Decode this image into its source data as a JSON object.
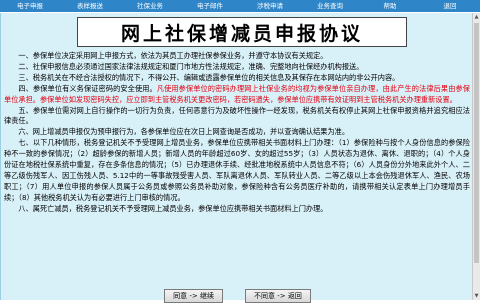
{
  "nav": {
    "items": [
      "电子申报",
      "表样报送",
      "社保业务",
      "电子邮件",
      "涉税申请",
      "业务查询",
      "帮助",
      "退回"
    ]
  },
  "title": "网上社保增减员申报协议",
  "paragraphs": {
    "p1": "一、参保单位决定采用网上申报方式，依法为其员工办理社保参保业务，并遵守本协议有关规定。",
    "p2": "二、社保申报信息必须通过国家法律法规规定和厦门市地方性法规规定，准确、完整地向社保经办机构报送。",
    "p3": "三、税务机关在不经合法授权的情况下，不得公开、编辑或透露参保单位的相关信息及其保存在本网站内的非公开内容。",
    "p4_a": "四、参保单位有义务保证密码的安全使用。",
    "p4_red": "凡使用参保单位的密码办理网上社保业务的均视为参保单位亲自办理，由此产生的法律后果由参保单位承担。参保单位如发现密码失控，应立即到主管税务机关更改密码，若密码遗失，参保单位应携带有效证明到主管税务机关办理重新设置。",
    "p5": "五、参保单位需对网上自行操作的一切行为负责，任何恶意行为及破坏性操作一经发现，税务机关有权停止其网上社保申报资格并追究相应法律责任。",
    "p6": "六、网上增减员申报仅为预申报行为，各参保单位应在次日上网查询是否成功，并以查询确认结果为准。",
    "p7": "七、以下几种情形，税务登记机关不予受理网上增员业务，参保单位应携带相关书面材料上门办理：（1）参保险种与按个人身份信息的参保险种不一致的参保情况；（2）超龄参保的新增人员；新增人员的年龄超过60岁、女的超过55岁；（3）人员状态为退休、离休、退职的；（4）个人身份证在地税社保系统中重复，存在多条信息的情况；（5）已办理退休手续、经批准地税系统中人员信息不符；（6）人员身份分外地来此外个人、二等乙级伤残军人、因工伤残人员、5.12中的一等事故残受害人员、军队离退休人员、军队转业人员、二等乙级以上本会伤残退休军人、渔民、农场职工；（7）用人单位申报的参保人员属于公务员或参照公务员补助对象，参保险种含有公务员医疗补助的，请携带相关认定表单上门办理增员手续；（8）其他税务机关认为有必要进行上门审核的情况。",
    "p8": "八、属死亡减员，税务登记机关不予受理网上减员业务，参保单位应携带相关书面材料上门办理。"
  },
  "buttons": {
    "agree": "同意 -> 继续",
    "disagree": "不同意 -> 返回"
  }
}
